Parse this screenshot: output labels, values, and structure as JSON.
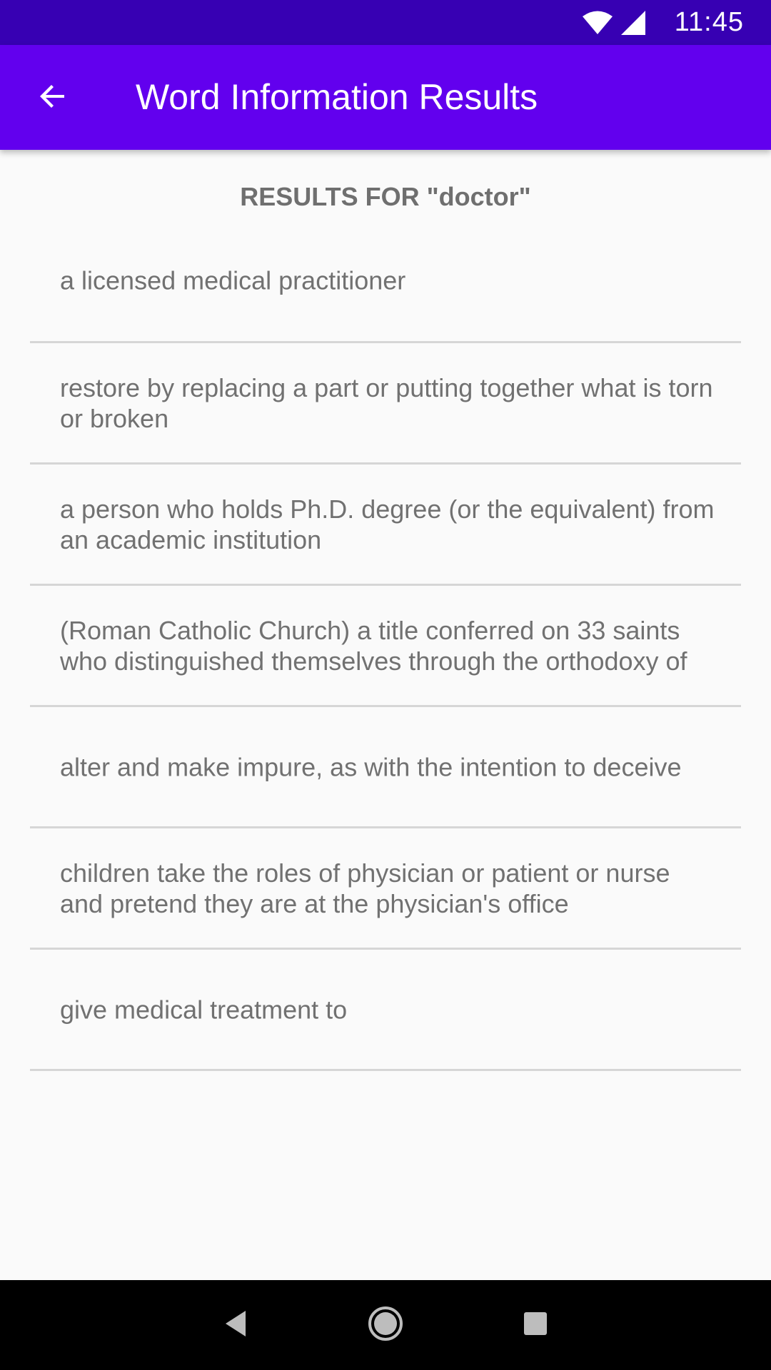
{
  "status_bar": {
    "time": "11:45",
    "icons": [
      "wifi-icon",
      "signal-icon"
    ]
  },
  "app_bar": {
    "back_icon": "arrow-back-icon",
    "title": "Word Information Results"
  },
  "results": {
    "heading": "RESULTS FOR \"doctor\"",
    "items": [
      {
        "text": "a licensed medical practitioner"
      },
      {
        "text": "restore by replacing a part or putting together what is torn or broken"
      },
      {
        "text": "a person who holds Ph.D. degree (or the equivalent) from an academic institution"
      },
      {
        "text": "(Roman Catholic Church) a title conferred on 33 saints who distinguished themselves through the orthodoxy of"
      },
      {
        "text": "alter and make impure, as with the intention to deceive"
      },
      {
        "text": "children take the roles of physician or patient or nurse and pretend they are at the physician's office"
      },
      {
        "text": "give medical treatment to"
      }
    ]
  },
  "nav_bar": {
    "icons": [
      "nav-back-icon",
      "nav-home-icon",
      "nav-recents-icon"
    ]
  },
  "colors": {
    "status_bar": "#3700B3",
    "app_bar": "#6200EE",
    "background": "#FAFAFA",
    "text": "#717171",
    "divider": "#D6D6D6"
  }
}
